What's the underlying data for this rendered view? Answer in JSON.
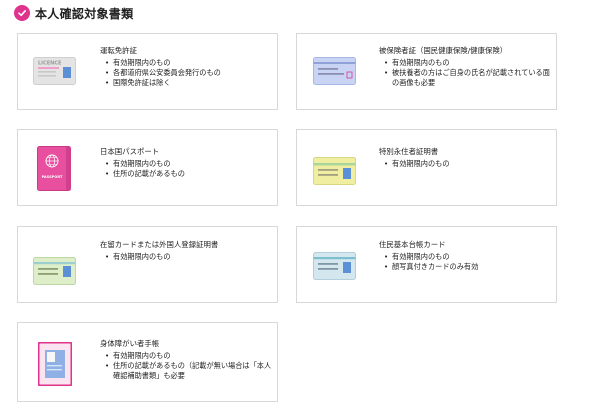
{
  "header": {
    "title": "本人確認対象書類"
  },
  "cards": [
    {
      "name": "運転免許証",
      "card_text": "LICENCE",
      "items": [
        "有効期限内のもの",
        "各都道府県公安委員会発行のもの",
        "国際免許証は除く"
      ]
    },
    {
      "name": "被保険者証（国民健康保険/健康保険）",
      "items": [
        "有効期限内のもの",
        "被扶養者の方はご自身の氏名が記載されている面の画像も必要"
      ]
    },
    {
      "name": "日本国パスポート",
      "card_text": "PASSPORT",
      "items": [
        "有効期限内のもの",
        "住所の記載があるもの"
      ]
    },
    {
      "name": "特別永住者証明書",
      "items": [
        "有効期限内のもの"
      ]
    },
    {
      "name": "在留カードまたは外国人登録証明書",
      "items": [
        "有効期限内のもの"
      ]
    },
    {
      "name": "住民基本台帳カード",
      "items": [
        "有効期限内のもの",
        "顔写真付きカードのみ有効"
      ]
    },
    {
      "name": "身体障がい者手帳",
      "items": [
        "有効期限内のもの",
        "住所の記載があるもの（記載が無い場合は「本人確認補助書類」も必要"
      ]
    }
  ],
  "colors": {
    "accent": "#e0338e",
    "border": "#d8d8d8"
  }
}
